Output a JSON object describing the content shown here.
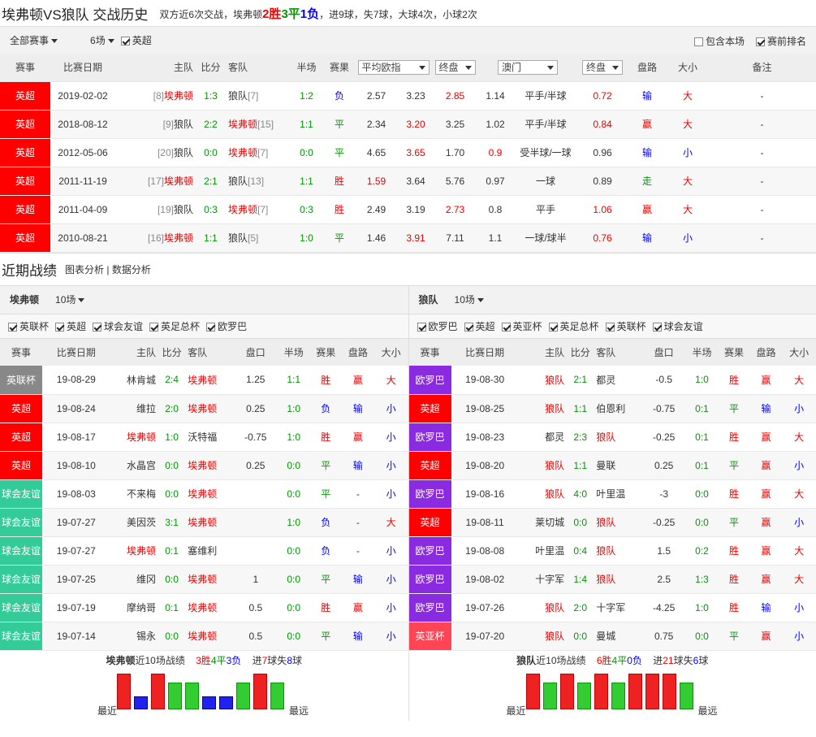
{
  "header": {
    "title": "埃弗顿VS狼队 交战历史",
    "summary_prefix": "双方近6次交战，埃弗顿",
    "wins": "2胜",
    "draws": "3平",
    "losses": "1负",
    "summary_suffix": "，进9球，失7球，大球4次，小球2次"
  },
  "toolbar": {
    "competition_filter": "全部赛事",
    "matches_filter": "6场",
    "league_check": "英超",
    "include_this": "包含本场",
    "pre_rank": "赛前排名"
  },
  "h2h_headers": {
    "league": "赛事",
    "date": "比赛日期",
    "home": "主队",
    "score": "比分",
    "away": "客队",
    "half": "半场",
    "result": "赛果",
    "odds_type": "平均欧指",
    "odds_stage": "终盘",
    "company": "澳门",
    "hcp_stage": "终盘",
    "hcp_result": "盘路",
    "ou": "大小",
    "note": "备注"
  },
  "h2h_rows": [
    {
      "league": "英超",
      "date": "2019-02-02",
      "home_rank": "[8]",
      "home": "埃弗顿",
      "home_c": "red",
      "score": "1:3",
      "away": "狼队",
      "away_c": "black",
      "away_rank": "[7]",
      "half": "1:2",
      "result": "负",
      "result_c": "blue",
      "o1": "2.57",
      "o1c": "black",
      "o2": "3.23",
      "o2c": "black",
      "o3": "2.85",
      "o3c": "red",
      "hw": "1.14",
      "hwc": "black",
      "line": "平手/半球",
      "hl": "0.72",
      "hlc": "red",
      "pan": "输",
      "panc": "blue",
      "ouv": "大",
      "ouc": "red",
      "note": "-"
    },
    {
      "league": "英超",
      "date": "2018-08-12",
      "home_rank": "[9]",
      "home": "狼队",
      "home_c": "black",
      "score": "2:2",
      "away": "埃弗顿",
      "away_c": "red",
      "away_rank": "[15]",
      "half": "1:1",
      "result": "平",
      "result_c": "green",
      "o1": "2.34",
      "o1c": "black",
      "o2": "3.20",
      "o2c": "red",
      "o3": "3.25",
      "o3c": "black",
      "hw": "1.02",
      "hwc": "black",
      "line": "平手/半球",
      "hl": "0.84",
      "hlc": "red",
      "pan": "赢",
      "panc": "red",
      "ouv": "大",
      "ouc": "red",
      "note": "-"
    },
    {
      "league": "英超",
      "date": "2012-05-06",
      "home_rank": "[20]",
      "home": "狼队",
      "home_c": "black",
      "score": "0:0",
      "away": "埃弗顿",
      "away_c": "red",
      "away_rank": "[7]",
      "half": "0:0",
      "result": "平",
      "result_c": "green",
      "o1": "4.65",
      "o1c": "black",
      "o2": "3.65",
      "o2c": "red",
      "o3": "1.70",
      "o3c": "black",
      "hw": "0.9",
      "hwc": "red",
      "line": "受半球/一球",
      "hl": "0.96",
      "hlc": "black",
      "pan": "输",
      "panc": "blue",
      "ouv": "小",
      "ouc": "blue",
      "note": "-"
    },
    {
      "league": "英超",
      "date": "2011-11-19",
      "home_rank": "[17]",
      "home": "埃弗顿",
      "home_c": "red",
      "score": "2:1",
      "away": "狼队",
      "away_c": "black",
      "away_rank": "[13]",
      "half": "1:1",
      "result": "胜",
      "result_c": "red",
      "o1": "1.59",
      "o1c": "red",
      "o2": "3.64",
      "o2c": "black",
      "o3": "5.76",
      "o3c": "black",
      "hw": "0.97",
      "hwc": "black",
      "line": "一球",
      "hl": "0.89",
      "hlc": "black",
      "pan": "走",
      "panc": "green",
      "ouv": "大",
      "ouc": "red",
      "note": "-"
    },
    {
      "league": "英超",
      "date": "2011-04-09",
      "home_rank": "[19]",
      "home": "狼队",
      "home_c": "black",
      "score": "0:3",
      "away": "埃弗顿",
      "away_c": "red",
      "away_rank": "[7]",
      "half": "0:3",
      "result": "胜",
      "result_c": "red",
      "o1": "2.49",
      "o1c": "black",
      "o2": "3.19",
      "o2c": "black",
      "o3": "2.73",
      "o3c": "red",
      "hw": "0.8",
      "hwc": "black",
      "line": "平手",
      "hl": "1.06",
      "hlc": "red",
      "pan": "赢",
      "panc": "red",
      "ouv": "大",
      "ouc": "red",
      "note": "-"
    },
    {
      "league": "英超",
      "date": "2010-08-21",
      "home_rank": "[16]",
      "home": "埃弗顿",
      "home_c": "red",
      "score": "1:1",
      "away": "狼队",
      "away_c": "black",
      "away_rank": "[5]",
      "half": "1:0",
      "result": "平",
      "result_c": "green",
      "o1": "1.46",
      "o1c": "black",
      "o2": "3.91",
      "o2c": "red",
      "o3": "7.11",
      "o3c": "black",
      "hw": "1.1",
      "hwc": "black",
      "line": "一球/球半",
      "hl": "0.76",
      "hlc": "red",
      "pan": "输",
      "panc": "blue",
      "ouv": "小",
      "ouc": "blue",
      "note": "-"
    }
  ],
  "recent": {
    "title": "近期战绩",
    "link1": "图表分析",
    "sep": "|",
    "link2": "数据分析"
  },
  "recent_headers": {
    "league": "赛事",
    "date": "比赛日期",
    "home": "主队",
    "score": "比分",
    "away": "客队",
    "hcp": "盘口",
    "half": "半场",
    "result": "赛果",
    "pan": "盘路",
    "ou": "大小"
  },
  "left": {
    "team": "埃弗顿",
    "count": "10场",
    "filters": [
      "英联杯",
      "英超",
      "球会友谊",
      "英足总杯",
      "欧罗巴"
    ],
    "rows": [
      {
        "lg": "英联杯",
        "cls": "c-elc",
        "date": "19-08-29",
        "home": "林肯城",
        "hc": "black",
        "score": "2:4",
        "away": "埃弗顿",
        "ac": "red",
        "hcp": "1.25",
        "half": "1:1",
        "res": "胜",
        "rc": "red",
        "pan": "赢",
        "pc": "red",
        "ou": "大",
        "oc": "red"
      },
      {
        "lg": "英超",
        "cls": "c-epl",
        "date": "19-08-24",
        "home": "维拉",
        "hc": "black",
        "score": "2:0",
        "away": "埃弗顿",
        "ac": "red",
        "hcp": "0.25",
        "half": "1:0",
        "res": "负",
        "rc": "blue",
        "pan": "输",
        "pc": "blue",
        "ou": "小",
        "oc": "blue"
      },
      {
        "lg": "英超",
        "cls": "c-epl",
        "date": "19-08-17",
        "home": "埃弗顿",
        "hc": "red",
        "score": "1:0",
        "away": "沃特福",
        "ac": "black",
        "hcp": "-0.75",
        "half": "1:0",
        "res": "胜",
        "rc": "red",
        "pan": "赢",
        "pc": "red",
        "ou": "小",
        "oc": "blue"
      },
      {
        "lg": "英超",
        "cls": "c-epl",
        "date": "19-08-10",
        "home": "水晶宫",
        "hc": "black",
        "score": "0:0",
        "away": "埃弗顿",
        "ac": "red",
        "hcp": "0.25",
        "half": "0:0",
        "res": "平",
        "rc": "green",
        "pan": "输",
        "pc": "blue",
        "ou": "小",
        "oc": "blue"
      },
      {
        "lg": "球会友谊",
        "cls": "c-fr",
        "date": "19-08-03",
        "home": "不来梅",
        "hc": "black",
        "score": "0:0",
        "away": "埃弗顿",
        "ac": "red",
        "hcp": "",
        "half": "0:0",
        "res": "平",
        "rc": "green",
        "pan": "-",
        "pc": "black",
        "ou": "小",
        "oc": "blue"
      },
      {
        "lg": "球会友谊",
        "cls": "c-fr",
        "date": "19-07-27",
        "home": "美因茨",
        "hc": "black",
        "score": "3:1",
        "away": "埃弗顿",
        "ac": "red",
        "hcp": "",
        "half": "1:0",
        "res": "负",
        "rc": "blue",
        "pan": "-",
        "pc": "black",
        "ou": "大",
        "oc": "red"
      },
      {
        "lg": "球会友谊",
        "cls": "c-fr",
        "date": "19-07-27",
        "home": "埃弗顿",
        "hc": "red",
        "score": "0:1",
        "away": "塞维利",
        "ac": "black",
        "hcp": "",
        "half": "0:0",
        "res": "负",
        "rc": "blue",
        "pan": "-",
        "pc": "black",
        "ou": "小",
        "oc": "blue"
      },
      {
        "lg": "球会友谊",
        "cls": "c-fr",
        "date": "19-07-25",
        "home": "维冈",
        "hc": "black",
        "score": "0:0",
        "away": "埃弗顿",
        "ac": "red",
        "hcp": "1",
        "half": "0:0",
        "res": "平",
        "rc": "green",
        "pan": "输",
        "pc": "blue",
        "ou": "小",
        "oc": "blue"
      },
      {
        "lg": "球会友谊",
        "cls": "c-fr",
        "date": "19-07-19",
        "home": "摩纳哥",
        "hc": "black",
        "score": "0:1",
        "away": "埃弗顿",
        "ac": "red",
        "hcp": "0.5",
        "half": "0:0",
        "res": "胜",
        "rc": "red",
        "pan": "赢",
        "pc": "red",
        "ou": "小",
        "oc": "blue"
      },
      {
        "lg": "球会友谊",
        "cls": "c-fr",
        "date": "19-07-14",
        "home": "锡永",
        "hc": "black",
        "score": "0:0",
        "away": "埃弗顿",
        "ac": "red",
        "hcp": "0.5",
        "half": "0:0",
        "res": "平",
        "rc": "green",
        "pan": "输",
        "pc": "blue",
        "ou": "小",
        "oc": "blue"
      }
    ],
    "sum_team": "埃弗顿",
    "sum_mid": "近10场战绩",
    "sum_w": "3胜",
    "sum_d": "4平",
    "sum_l": "3负",
    "sum_gf_pre": "进",
    "sum_gf": "7",
    "sum_ga_pre": "球失",
    "sum_ga": "8",
    "sum_ga_suf": "球",
    "chart_labels": [
      "最近",
      "最远"
    ],
    "chart_data": {
      "type": "bar",
      "categories": [
        "1",
        "2",
        "3",
        "4",
        "5",
        "6",
        "7",
        "8",
        "9",
        "10"
      ],
      "values": [
        "胜",
        "负",
        "胜",
        "平",
        "平",
        "负",
        "负",
        "平",
        "胜",
        "平"
      ]
    }
  },
  "right": {
    "team": "狼队",
    "count": "10场",
    "filters": [
      "欧罗巴",
      "英超",
      "英亚杯",
      "英足总杯",
      "英联杯",
      "球会友谊"
    ],
    "rows": [
      {
        "lg": "欧罗巴",
        "cls": "c-uel",
        "date": "19-08-30",
        "home": "狼队",
        "hc": "red",
        "score": "2:1",
        "away": "都灵",
        "ac": "black",
        "hcp": "-0.5",
        "half": "1:0",
        "res": "胜",
        "rc": "red",
        "pan": "赢",
        "pc": "red",
        "ou": "大",
        "oc": "red"
      },
      {
        "lg": "英超",
        "cls": "c-epl",
        "date": "19-08-25",
        "home": "狼队",
        "hc": "red",
        "score": "1:1",
        "away": "伯恩利",
        "ac": "black",
        "hcp": "-0.75",
        "half": "0:1",
        "res": "平",
        "rc": "green",
        "pan": "输",
        "pc": "blue",
        "ou": "小",
        "oc": "blue"
      },
      {
        "lg": "欧罗巴",
        "cls": "c-uel",
        "date": "19-08-23",
        "home": "都灵",
        "hc": "black",
        "score": "2:3",
        "away": "狼队",
        "ac": "red",
        "hcp": "-0.25",
        "half": "0:1",
        "res": "胜",
        "rc": "red",
        "pan": "赢",
        "pc": "red",
        "ou": "大",
        "oc": "red"
      },
      {
        "lg": "英超",
        "cls": "c-epl",
        "date": "19-08-20",
        "home": "狼队",
        "hc": "red",
        "score": "1:1",
        "away": "曼联",
        "ac": "black",
        "hcp": "0.25",
        "half": "0:1",
        "res": "平",
        "rc": "green",
        "pan": "赢",
        "pc": "red",
        "ou": "小",
        "oc": "blue"
      },
      {
        "lg": "欧罗巴",
        "cls": "c-uel",
        "date": "19-08-16",
        "home": "狼队",
        "hc": "red",
        "score": "4:0",
        "away": "叶里温",
        "ac": "black",
        "hcp": "-3",
        "half": "0:0",
        "res": "胜",
        "rc": "red",
        "pan": "赢",
        "pc": "red",
        "ou": "大",
        "oc": "red"
      },
      {
        "lg": "英超",
        "cls": "c-epl",
        "date": "19-08-11",
        "home": "莱切城",
        "hc": "black",
        "score": "0:0",
        "away": "狼队",
        "ac": "red",
        "hcp": "-0.25",
        "half": "0:0",
        "res": "平",
        "rc": "green",
        "pan": "赢",
        "pc": "red",
        "ou": "小",
        "oc": "blue"
      },
      {
        "lg": "欧罗巴",
        "cls": "c-uel",
        "date": "19-08-08",
        "home": "叶里温",
        "hc": "black",
        "score": "0:4",
        "away": "狼队",
        "ac": "red",
        "hcp": "1.5",
        "half": "0:2",
        "res": "胜",
        "rc": "red",
        "pan": "赢",
        "pc": "red",
        "ou": "大",
        "oc": "red"
      },
      {
        "lg": "欧罗巴",
        "cls": "c-uel",
        "date": "19-08-02",
        "home": "十字军",
        "hc": "black",
        "score": "1:4",
        "away": "狼队",
        "ac": "red",
        "hcp": "2.5",
        "half": "1:3",
        "res": "胜",
        "rc": "red",
        "pan": "赢",
        "pc": "red",
        "ou": "大",
        "oc": "red"
      },
      {
        "lg": "欧罗巴",
        "cls": "c-uel",
        "date": "19-07-26",
        "home": "狼队",
        "hc": "red",
        "score": "2:0",
        "away": "十字军",
        "ac": "black",
        "hcp": "-4.25",
        "half": "1:0",
        "res": "胜",
        "rc": "red",
        "pan": "输",
        "pc": "blue",
        "ou": "小",
        "oc": "blue"
      },
      {
        "lg": "英亚杯",
        "cls": "c-ec",
        "date": "19-07-20",
        "home": "狼队",
        "hc": "red",
        "score": "0:0",
        "away": "曼城",
        "ac": "black",
        "hcp": "0.75",
        "half": "0:0",
        "res": "平",
        "rc": "green",
        "pan": "赢",
        "pc": "red",
        "ou": "小",
        "oc": "blue"
      }
    ],
    "sum_team": "狼队",
    "sum_mid": "近10场战绩",
    "sum_w": "6胜",
    "sum_d": "4平",
    "sum_l": "0负",
    "sum_gf_pre": "进",
    "sum_gf": "21",
    "sum_ga_pre": "球失",
    "sum_ga": "6",
    "sum_ga_suf": "球",
    "chart_labels": [
      "最近",
      "最远"
    ],
    "chart_data": {
      "type": "bar",
      "categories": [
        "1",
        "2",
        "3",
        "4",
        "5",
        "6",
        "7",
        "8",
        "9",
        "10"
      ],
      "values": [
        "胜",
        "平",
        "胜",
        "平",
        "胜",
        "平",
        "胜",
        "胜",
        "胜",
        "平"
      ]
    }
  }
}
